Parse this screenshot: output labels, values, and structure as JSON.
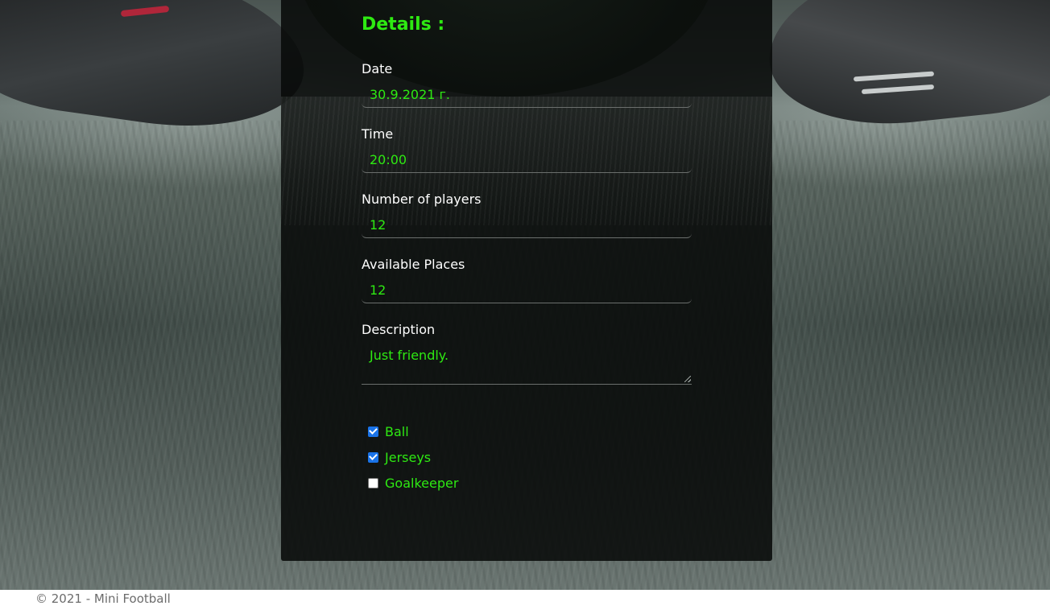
{
  "details": {
    "title": "Details :",
    "fields": [
      {
        "label": "Date",
        "value": "30.9.2021 г."
      },
      {
        "label": "Time",
        "value": "20:00"
      },
      {
        "label": "Number of players",
        "value": "12"
      },
      {
        "label": "Available Places",
        "value": "12"
      },
      {
        "label": "Description",
        "value": "Just friendly."
      }
    ],
    "checkboxes": [
      {
        "label": "Ball",
        "checked": true
      },
      {
        "label": "Jerseys",
        "checked": true
      },
      {
        "label": "Goalkeeper",
        "checked": false
      }
    ]
  },
  "footer": {
    "text": "© 2021 - Mini Football"
  },
  "colors": {
    "accent": "#2eea12",
    "panel": "#080a09",
    "checkbox_checked": "#1a73e8"
  }
}
